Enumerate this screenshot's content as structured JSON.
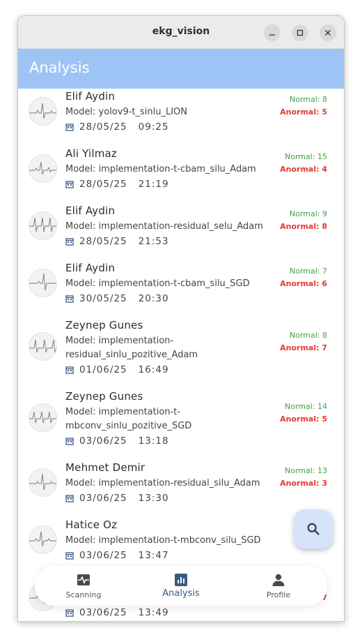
{
  "window": {
    "title": "ekg_vision"
  },
  "appbar": {
    "title": "Analysis"
  },
  "records": [
    {
      "name": "Elif Aydin",
      "model": "Model: yolov9-t_sinlu_LION",
      "date": "28/05/25",
      "time": "09:25",
      "normal": "Normal: 8",
      "anormal": "Anormal: 5"
    },
    {
      "name": "Ali Yilmaz",
      "model": "Model: implementation-t-cbam_silu_Adam",
      "date": "28/05/25",
      "time": "21:19",
      "normal": "Normal: 15",
      "anormal": "Anormal: 4"
    },
    {
      "name": "Elif Aydin",
      "model": "Model: implementation-residual_selu_Adam",
      "date": "28/05/25",
      "time": "21:53",
      "normal": "Normal: 9",
      "anormal": "Anormal: 8"
    },
    {
      "name": "Elif Aydin",
      "model": "Model: implementation-t-cbam_silu_SGD",
      "date": "30/05/25",
      "time": "20:30",
      "normal": "Normal: 7",
      "anormal": "Anormal: 6"
    },
    {
      "name": "Zeynep Gunes",
      "model": "Model: implementation-residual_sinlu_pozitive_Adam",
      "date": "01/06/25",
      "time": "16:49",
      "normal": "Normal: 8",
      "anormal": "Anormal: 7"
    },
    {
      "name": "Zeynep Gunes",
      "model": "Model: implementation-t-mbconv_sinlu_pozitive_SGD",
      "date": "03/06/25",
      "time": "13:18",
      "normal": "Normal: 14",
      "anormal": "Anormal: 5"
    },
    {
      "name": "Mehmet Demir",
      "model": "Model: implementation-residual_silu_Adam",
      "date": "03/06/25",
      "time": "13:30",
      "normal": "Normal: 13",
      "anormal": "Anormal: 3"
    },
    {
      "name": "Hatice Oz",
      "model": "Model: implementation-t-mbconv_silu_SGD",
      "date": "03/06/25",
      "time": "13:47",
      "normal": "No",
      "anormal": "An"
    },
    {
      "name": "",
      "model": "",
      "date": "03/06/25",
      "time": "13:49",
      "normal": "",
      "anormal": "7"
    }
  ],
  "nav": {
    "scanning": "Scanning",
    "analysis": "Analysis",
    "profile": "Profile"
  },
  "icons": {
    "fab": "search-icon",
    "scanning": "heart-monitor-icon",
    "analysis": "bar-chart-icon",
    "profile": "person-icon",
    "date": "calendar-icon"
  },
  "colors": {
    "appbar": "#9ec4f5",
    "normal": "#43a047",
    "anormal": "#e53935",
    "active_nav": "#3a5a85",
    "fab": "#d6e4fb"
  }
}
